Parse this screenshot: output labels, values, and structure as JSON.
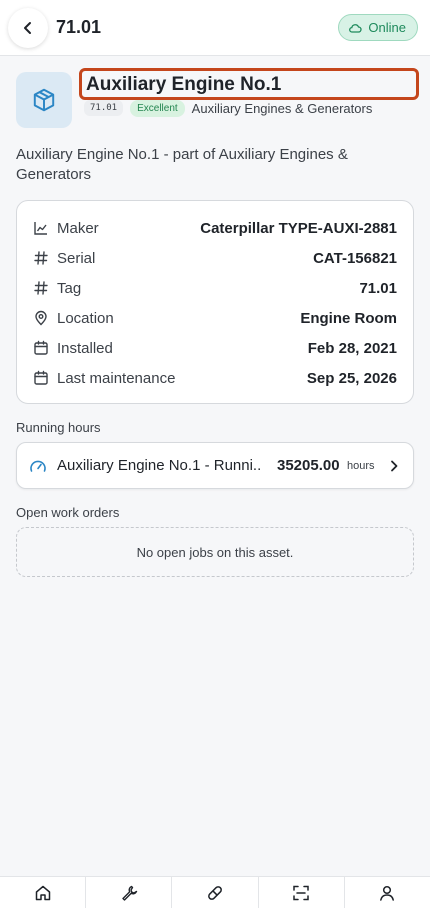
{
  "header": {
    "title": "71.01",
    "status_label": "Online",
    "back_icon": "chevron-left-icon",
    "status_icon": "cloud-icon"
  },
  "asset": {
    "icon": "box-icon",
    "name": "Auxiliary Engine No.1",
    "tag": "71.01",
    "condition": "Excellent",
    "category": "Auxiliary Engines & Generators",
    "description": "Auxiliary Engine No.1 - part of Auxiliary Engines & Generators"
  },
  "details": [
    {
      "icon": "chart-icon",
      "label": "Maker",
      "value": "Caterpillar TYPE-AUXI-2881"
    },
    {
      "icon": "hash-icon",
      "label": "Serial",
      "value": "CAT-156821"
    },
    {
      "icon": "hash-icon",
      "label": "Tag",
      "value": "71.01"
    },
    {
      "icon": "location-pin-icon",
      "label": "Location",
      "value": "Engine Room"
    },
    {
      "icon": "calendar-icon",
      "label": "Installed",
      "value": "Feb 28, 2021"
    },
    {
      "icon": "calendar-icon",
      "label": "Last maintenance",
      "value": "Sep 25, 2026"
    }
  ],
  "running_hours": {
    "section_label": "Running hours",
    "meter_name": "Auxiliary Engine No.1 - Runni...",
    "value": "35205.00",
    "unit": "hours"
  },
  "work_orders": {
    "section_label": "Open work orders",
    "empty_text": "No open jobs on this asset."
  },
  "bottom_nav": [
    "home-icon",
    "wrench-icon",
    "pill-icon",
    "scan-icon",
    "user-icon"
  ],
  "colors": {
    "accent": "#2b86c5",
    "highlight_border": "#c4461c",
    "online_bg": "#d8f2e6",
    "online_text": "#1e8a5c",
    "condition_bg": "#d8f2e0",
    "condition_text": "#23854f"
  }
}
